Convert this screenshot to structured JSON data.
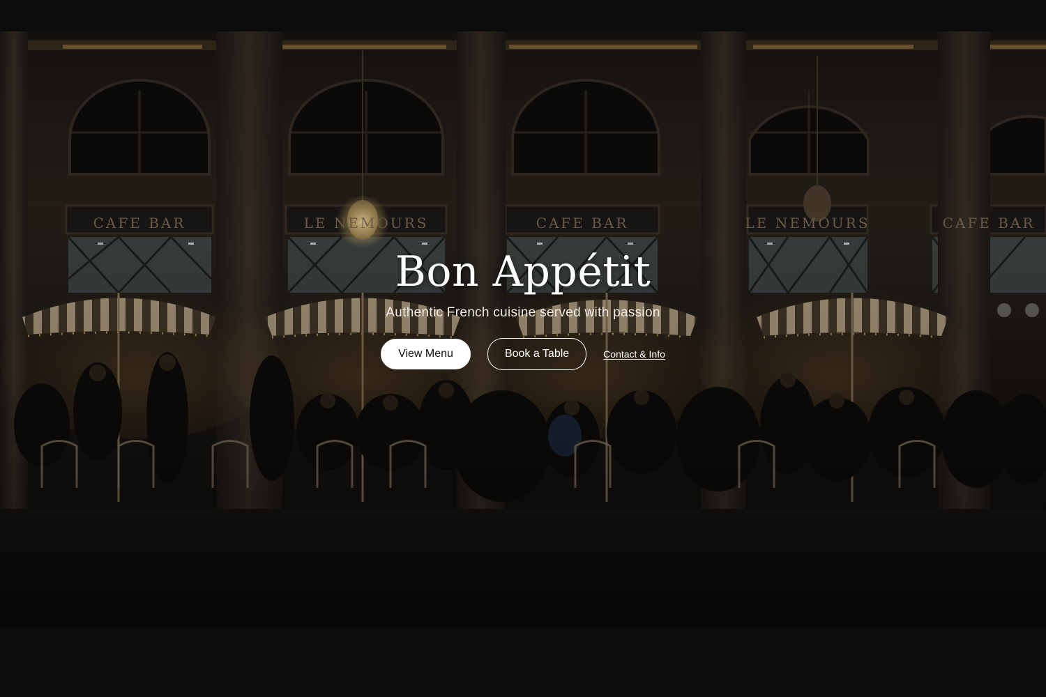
{
  "hero": {
    "title": "Bon Appétit",
    "subtitle": "Authentic French cuisine served with passion",
    "actions": {
      "view_menu": "View Menu",
      "book_table": "Book a Table",
      "contact": "Contact & Info"
    },
    "signs": [
      "CAFE  BAR",
      "LE NEMOURS",
      "CAFE  BAR",
      "LE NEMOURS",
      "CAFE  BAR"
    ]
  },
  "colors": {
    "page_background": "#0b0b0b",
    "primary_button_bg": "#ffffff",
    "primary_button_text": "#111111",
    "text": "#ffffff",
    "awning_stripe": "#cbb896"
  }
}
